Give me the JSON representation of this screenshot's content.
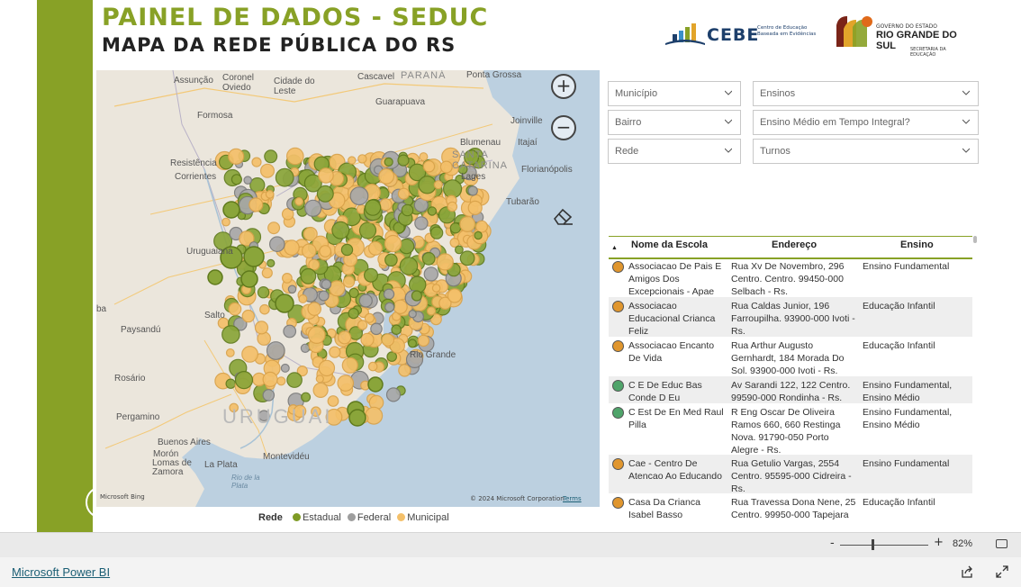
{
  "header": {
    "title": "PAINEL DE DADOS - SEDUC",
    "subtitle": "MAPA DA REDE PÚBLICA DO RS",
    "logo_cebe": {
      "name": "CEBE",
      "tagline": "Centro de Educação Baseada em Evidências"
    },
    "logo_rs": {
      "gov": "GOVERNO DO ESTADO",
      "name": "RIO GRANDE DO SUL",
      "sec": "SECRETARIA DA EDUCAÇÃO"
    }
  },
  "sidebar": {
    "info_icon": "info-icon",
    "info_glyph": "i"
  },
  "map": {
    "labels": {
      "asuncion": "Assunção",
      "coronel_oviedo": "Coronel\nOviedo",
      "cidade_leste": "Cidade do\nLeste",
      "cascavel": "Cascavel",
      "parana": "PARANÁ",
      "ponta_grossa": "Ponta Grossa",
      "guarapuava": "Guarapuava",
      "formosa": "Formosa",
      "joinville": "Joinville",
      "blumenau": "Blumenau",
      "itajai": "Itajaí",
      "santa_catarina": "SANTA\nCATARINA",
      "florianopolis": "Florianópolis",
      "lages": "Lages",
      "tubarao": "Tubarão",
      "resistencia": "Resistência",
      "corrientes": "Corrientes",
      "uruguaiana": "Uruguaiana",
      "salto": "Salto",
      "paysandu": "Paysandú",
      "rosario": "Rosário",
      "pergamino": "Pergamino",
      "uruguai": "URUGUAI",
      "rio_grande": "Rio Grande",
      "buenos_aires": "Buenos Aires",
      "moron": "Morón",
      "lomas_zamora": "Lomas de\nZamora",
      "la_plata": "La Plata",
      "montevideu": "Montevidéu",
      "rio_da_prata": "Rio de la\nPlata",
      "ba": "ba"
    },
    "zoom_in": "+",
    "zoom_out": "−",
    "attribution": "© 2024 Microsoft Corporation",
    "terms": "Terms",
    "bing": "Microsoft Bing"
  },
  "legend": {
    "title": "Rede",
    "items": [
      {
        "label": "Estadual",
        "color": "#7f9b25"
      },
      {
        "label": "Federal",
        "color": "#9e9e9e"
      },
      {
        "label": "Municipal",
        "color": "#f4c06a"
      }
    ]
  },
  "filters": {
    "municipio": "Município",
    "ensinos": "Ensinos",
    "bairro": "Bairro",
    "tempo_integral": "Ensino Médio em Tempo Integral?",
    "rede": "Rede",
    "turnos": "Turnos"
  },
  "table": {
    "sort_indicator": "▲",
    "headers": {
      "nome": "Nome da Escola",
      "endereco": "Endereço",
      "ensino": "Ensino"
    },
    "rows": [
      {
        "color": "#e0962e",
        "nome": "Associacao De Pais E Amigos Dos Excepcionais - Apae",
        "endereco": "Rua Xv De Novembro, 296 Centro. Centro. 99450-000 Selbach - Rs.",
        "ensino": "Ensino Fundamental"
      },
      {
        "color": "#e0962e",
        "nome": "Associacao Educacional Crianca Feliz",
        "endereco": "Rua Caldas Junior, 196 Farroupilha. 93900-000 Ivoti - Rs.",
        "ensino": "Educação Infantil"
      },
      {
        "color": "#e0962e",
        "nome": "Associacao Encanto De Vida",
        "endereco": "Rua Arthur Augusto Gernhardt, 184 Morada Do Sol. 93900-000 Ivoti - Rs.",
        "ensino": "Educação Infantil"
      },
      {
        "color": "#4fa46a",
        "nome": "C E De Educ Bas Conde D Eu",
        "endereco": "Av Sarandi 122, 122 Centro. 99590-000 Rondinha - Rs.",
        "ensino": "Ensino Fundamental, Ensino Médio"
      },
      {
        "color": "#4fa46a",
        "nome": "C Est De En Med Raul Pilla",
        "endereco": "R Eng Oscar De Oliveira Ramos 660, 660 Restinga Nova. 91790-050 Porto Alegre - Rs.",
        "ensino": "Ensino Fundamental, Ensino Médio"
      },
      {
        "color": "#e0962e",
        "nome": "Cae - Centro De Atencao Ao Educando",
        "endereco": "Rua Getulio Vargas, 2554 Centro. 95595-000 Cidreira - Rs.",
        "ensino": "Ensino Fundamental"
      },
      {
        "color": "#e0962e",
        "nome": "Casa Da Crianca Isabel Basso",
        "endereco": "Rua Travessa Dona Nene, 25 Centro. 99950-000 Tapejara",
        "ensino": "Educação Infantil"
      }
    ]
  },
  "statusbar": {
    "zoom_minus": "-",
    "zoom_plus": "+",
    "zoom": "82%"
  },
  "footer": {
    "link": "Microsoft Power BI"
  }
}
